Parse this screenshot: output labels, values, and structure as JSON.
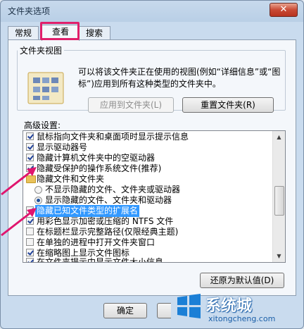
{
  "window": {
    "title": "文件夹选项",
    "close_glyph": "✕"
  },
  "tabs": [
    {
      "label": "常规"
    },
    {
      "label": "查看"
    },
    {
      "label": "搜索"
    }
  ],
  "folder_views": {
    "legend": "文件夹视图",
    "description": "可以将该文件夹正在使用的视图(例如“详细信息”或“图标”)应用到所有这种类型的文件夹中。",
    "apply_button": "应用到文件夹(L)",
    "reset_button": "重置文件夹(R)"
  },
  "advanced": {
    "label": "高级设置:",
    "items": [
      {
        "kind": "checkbox",
        "checked": true,
        "indent": 0,
        "label": "鼠标指向文件夹和桌面项时显示提示信息"
      },
      {
        "kind": "checkbox",
        "checked": true,
        "indent": 0,
        "label": "显示驱动器号"
      },
      {
        "kind": "checkbox",
        "checked": true,
        "indent": 0,
        "label": "隐藏计算机文件夹中的空驱动器"
      },
      {
        "kind": "checkbox",
        "checked": true,
        "indent": 0,
        "label": "隐藏受保护的操作系统文件(推荐)"
      },
      {
        "kind": "folder",
        "indent": 0,
        "label": "隐藏文件和文件夹"
      },
      {
        "kind": "radio",
        "checked": false,
        "indent": 1,
        "label": "不显示隐藏的文件、文件夹或驱动器"
      },
      {
        "kind": "radio",
        "checked": true,
        "indent": 1,
        "label": "显示隐藏的文件、文件夹和驱动器"
      },
      {
        "kind": "checkbox",
        "checked": true,
        "indent": 0,
        "selected": true,
        "label": "隐藏已知文件类型的扩展名"
      },
      {
        "kind": "checkbox",
        "checked": true,
        "indent": 0,
        "label": "用彩色显示加密或压缩的 NTFS 文件"
      },
      {
        "kind": "checkbox",
        "checked": false,
        "indent": 0,
        "label": "在标题栏显示完整路径(仅限经典主题)"
      },
      {
        "kind": "checkbox",
        "checked": false,
        "indent": 0,
        "label": "在单独的进程中打开文件夹窗口"
      },
      {
        "kind": "checkbox",
        "checked": true,
        "indent": 0,
        "label": "在缩略图上显示文件图标"
      },
      {
        "kind": "checkbox",
        "checked": true,
        "indent": 0,
        "label": "在文件夹提示中显示文件大小信息"
      }
    ],
    "restore_button": "还原为默认值(D)"
  },
  "footer": {
    "ok_button": "确定"
  },
  "watermark": {
    "brand": "系统城",
    "url": "xitongcheng.com"
  },
  "colors": {
    "highlight": "#e01f6a",
    "selection": "#3399ff",
    "arrow": "#e0156e"
  }
}
